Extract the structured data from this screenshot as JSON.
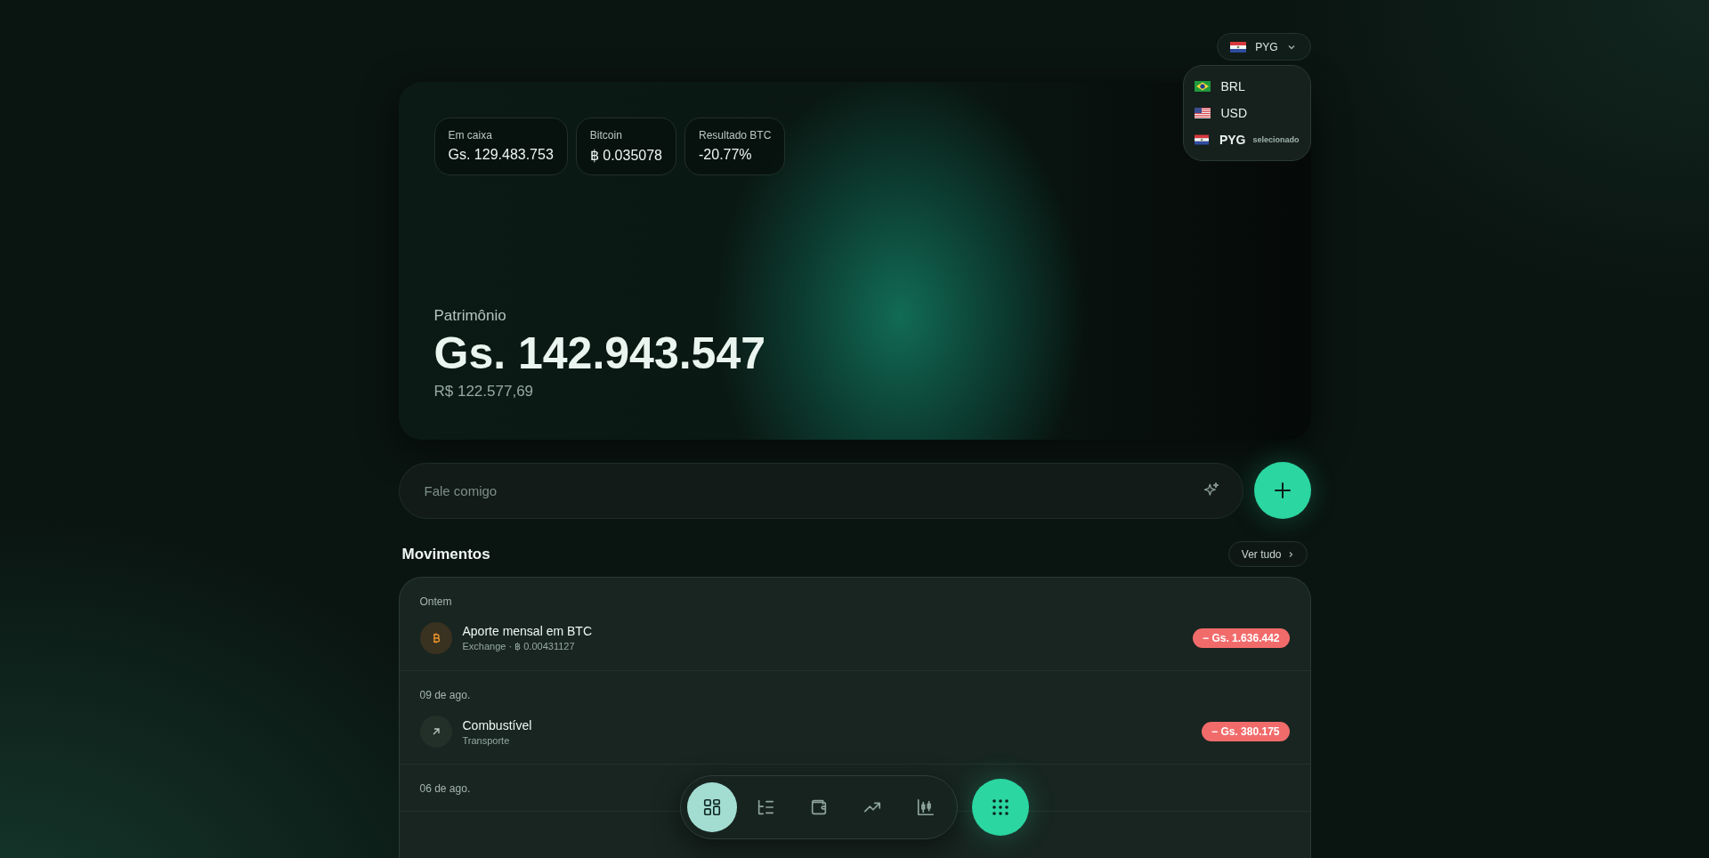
{
  "currency_selector": {
    "label": "PYG",
    "kind": "paraguay",
    "expanded": true,
    "options": [
      {
        "kind": "brazil",
        "label": "BRL",
        "selected": false
      },
      {
        "kind": "usa",
        "label": "USD",
        "selected": false
      },
      {
        "kind": "paraguay",
        "label": "PYG",
        "selected": true,
        "note": "selecionado"
      }
    ]
  },
  "stats": [
    {
      "label": "Em caixa",
      "value": "Gs. 129.483.753"
    },
    {
      "label": "Bitcoin",
      "value": "฿ 0.035078"
    },
    {
      "label": "Resultado BTC",
      "value": "-20.77%"
    }
  ],
  "net_worth": {
    "label": "Patrimônio",
    "value": "Gs. 142.943.547",
    "secondary": "R$ 122.577,69"
  },
  "chat": {
    "placeholder": "Fale comigo"
  },
  "movements": {
    "title": "Movimentos",
    "see_all": "Ver tudo",
    "groups": [
      {
        "date": "Ontem",
        "items": [
          {
            "kind": "bitcoin",
            "title": "Aporte mensal em BTC",
            "subtitle": "Exchange · ฿ 0.00431127",
            "amount": "− Gs. 1.636.442"
          }
        ]
      },
      {
        "date": "09 de ago.",
        "items": [
          {
            "kind": "arrow",
            "title": "Combustível",
            "subtitle": "Transporte",
            "amount": "− Gs. 380.175"
          }
        ]
      },
      {
        "date": "06 de ago."
      }
    ]
  },
  "bottom_nav": {
    "items": [
      {
        "kind": "dashboard",
        "selected": true
      },
      {
        "kind": "list",
        "selected": false
      },
      {
        "kind": "wallet",
        "selected": false
      },
      {
        "kind": "trend",
        "selected": false
      },
      {
        "kind": "candles",
        "selected": false
      }
    ]
  }
}
